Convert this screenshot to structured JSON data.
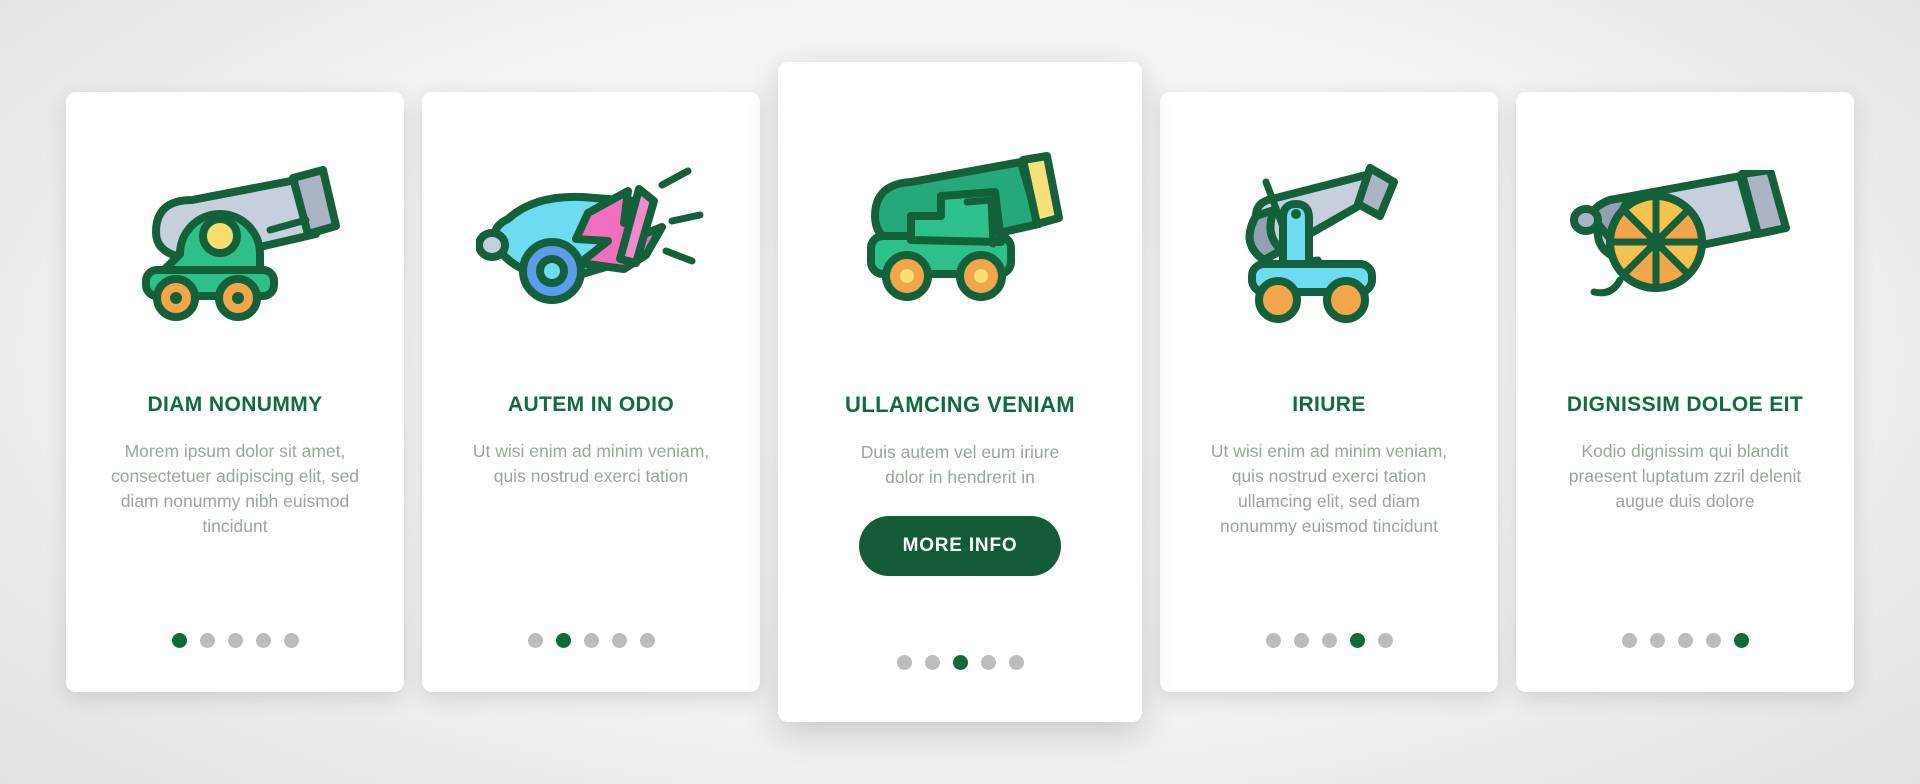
{
  "theme": {
    "brand_green": "#126B3F",
    "button_green": "#145B38",
    "body_text_gray": "#9aa69a",
    "dot_inactive": "#bcbcbc",
    "dot_active": "#106B3B",
    "card_background": "#ffffff",
    "page_background": "#dcdcdc"
  },
  "cards": [
    {
      "icon_name": "cannon-green-carriage-icon",
      "title": "DIAM NONUMMY",
      "body": "Morem ipsum dolor sit amet, consectetuer adipiscing elit, sed diam nonummy nibh euismod tincidunt",
      "dots": {
        "count": 5,
        "active_index": 0
      },
      "featured": false,
      "button_label": null
    },
    {
      "icon_name": "cannon-firing-blast-icon",
      "title": "AUTEM IN ODIO",
      "body": "Ut wisi enim ad minim veniam, quis nostrud exerci tation",
      "dots": {
        "count": 5,
        "active_index": 1
      },
      "featured": false,
      "button_label": null
    },
    {
      "icon_name": "cannon-green-cart-icon",
      "title": "ULLAMCING VENIAM",
      "body": "Duis autem vel eum iriure dolor in hendrerit in",
      "dots": {
        "count": 5,
        "active_index": 2
      },
      "featured": true,
      "button_label": "MORE INFO"
    },
    {
      "icon_name": "mortar-tripod-icon",
      "title": "IRIURE",
      "body": "Ut wisi enim ad minim veniam, quis nostrud exerci tation ullamcing elit, sed diam nonummy euismod tincidunt",
      "dots": {
        "count": 5,
        "active_index": 3
      },
      "featured": false,
      "button_label": null
    },
    {
      "icon_name": "cannon-spoked-wheel-icon",
      "title": "DIGNISSIM DOLOE EIT",
      "body": "Kodio dignissim qui blandit praesent luptatum zzril delenit augue duis dolore",
      "dots": {
        "count": 5,
        "active_index": 4
      },
      "featured": false,
      "button_label": null
    }
  ]
}
